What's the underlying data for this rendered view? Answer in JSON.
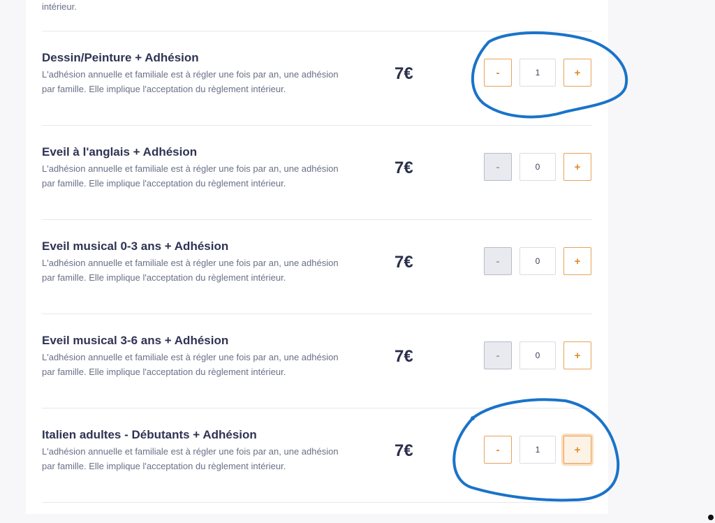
{
  "top_text": "intérieur.",
  "items": [
    {
      "title": "Dessin/Peinture + Adhésion",
      "desc": "L'adhésion annuelle et familiale est à régler une fois par an, une adhésion par famille. Elle implique l'acceptation du règlement intérieur.",
      "price": "7€",
      "minus": "-",
      "plus": "+",
      "qty": "1"
    },
    {
      "title": "Eveil à l'anglais + Adhésion",
      "desc": "L'adhésion annuelle et familiale est à régler une fois par an, une adhésion par famille. Elle implique l'acceptation du règlement intérieur.",
      "price": "7€",
      "minus": "-",
      "plus": "+",
      "qty": "0"
    },
    {
      "title": "Eveil musical 0-3 ans + Adhésion",
      "desc": "L'adhésion annuelle et familiale est à régler une fois par an, une adhésion par famille. Elle implique l'acceptation du règlement intérieur.",
      "price": "7€",
      "minus": "-",
      "plus": "+",
      "qty": "0"
    },
    {
      "title": "Eveil musical 3-6 ans + Adhésion",
      "desc": "L'adhésion annuelle et familiale est à régler une fois par an, une adhésion par famille. Elle implique l'acceptation du règlement intérieur.",
      "price": "7€",
      "minus": "-",
      "plus": "+",
      "qty": "0"
    },
    {
      "title": "Italien adultes - Débutants + Adhésion",
      "desc": "L'adhésion annuelle et familiale est à régler une fois par an, une adhésion par famille. Elle implique l'acceptation du règlement intérieur.",
      "price": "7€",
      "minus": "-",
      "plus": "+",
      "qty": "1"
    }
  ],
  "colors": {
    "accent": "#e08a2c",
    "annotation": "#1a73c9",
    "text": "#2b2f4b"
  }
}
